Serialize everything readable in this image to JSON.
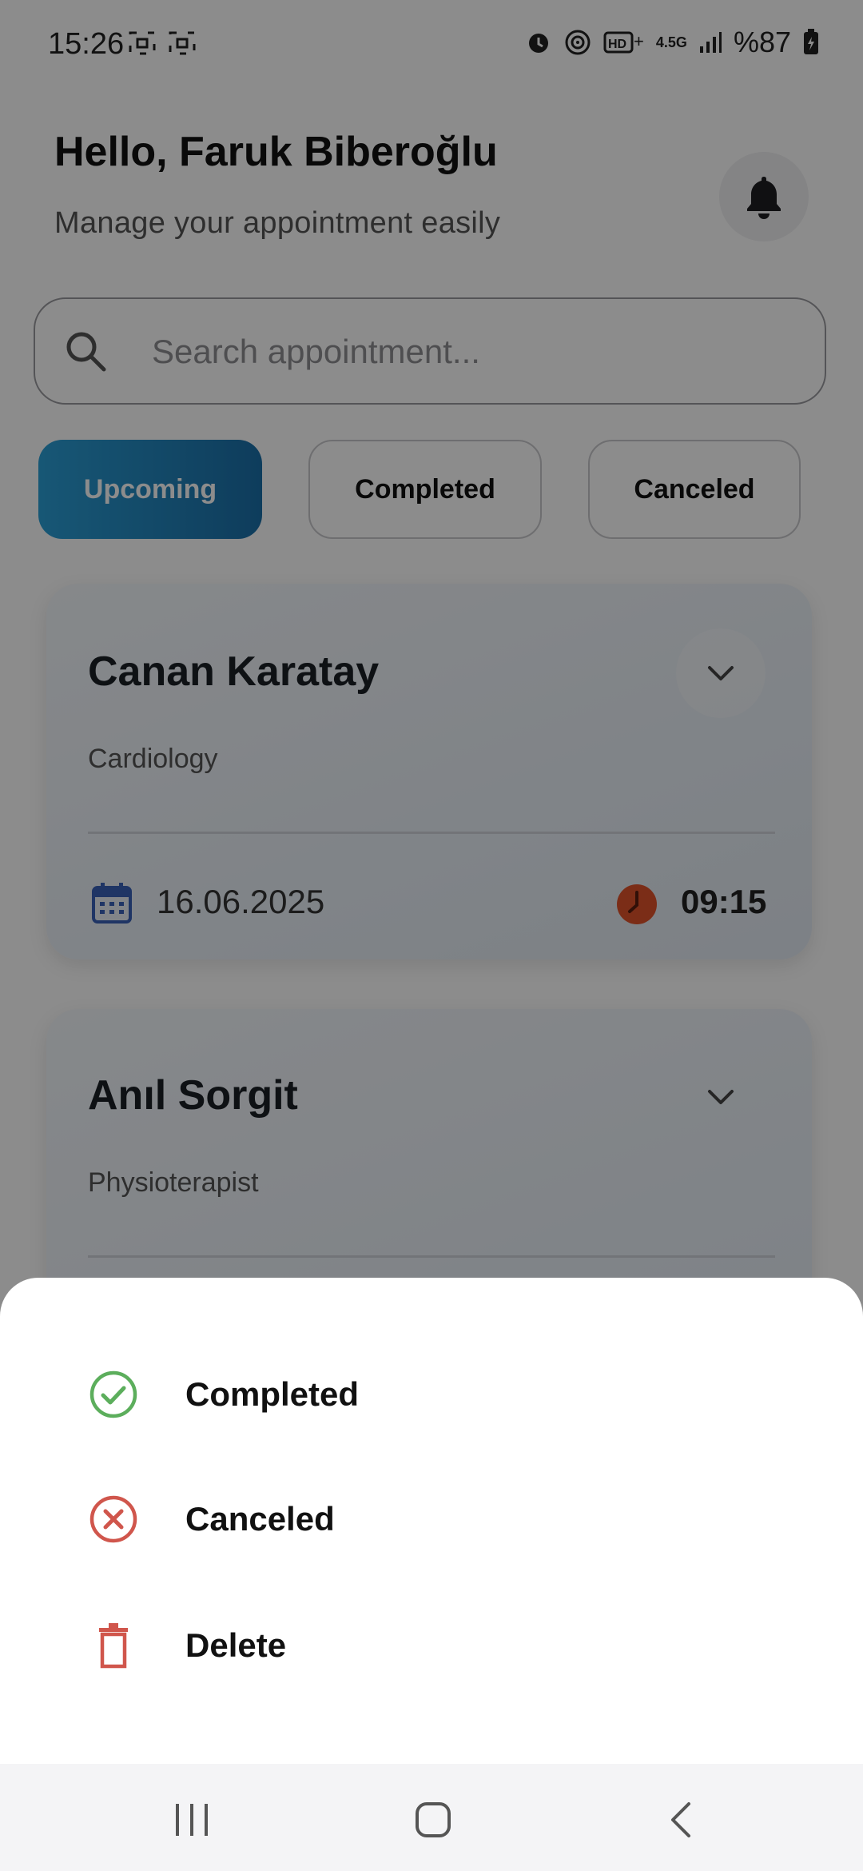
{
  "status_bar": {
    "time": "15:26",
    "battery": "%87",
    "network": "4.5G"
  },
  "header": {
    "greeting": "Hello, Faruk Biberoğlu",
    "subtitle": "Manage your appointment easily",
    "notification_icon": "bell-icon"
  },
  "search": {
    "placeholder": "Search appointment..."
  },
  "tabs": [
    {
      "label": "Upcoming",
      "active": true
    },
    {
      "label": "Completed",
      "active": false
    },
    {
      "label": "Canceled",
      "active": false
    }
  ],
  "appointments": [
    {
      "doctor": "Canan Karatay",
      "department": "Cardiology",
      "date": "16.06.2025",
      "time": "09:15"
    },
    {
      "doctor": "Anıl Sorgit",
      "department": "Physioterapist"
    }
  ],
  "action_sheet": {
    "items": [
      {
        "label": "Completed",
        "icon": "check-circle-icon",
        "color": "#5cae5c"
      },
      {
        "label": "Canceled",
        "icon": "x-circle-icon",
        "color": "#d0564c"
      },
      {
        "label": "Delete",
        "icon": "trash-icon",
        "color": "#d0564c"
      }
    ]
  },
  "colors": {
    "accent": "#1b6fa8",
    "clock": "#e0532b",
    "calendar": "#3a62b8"
  }
}
